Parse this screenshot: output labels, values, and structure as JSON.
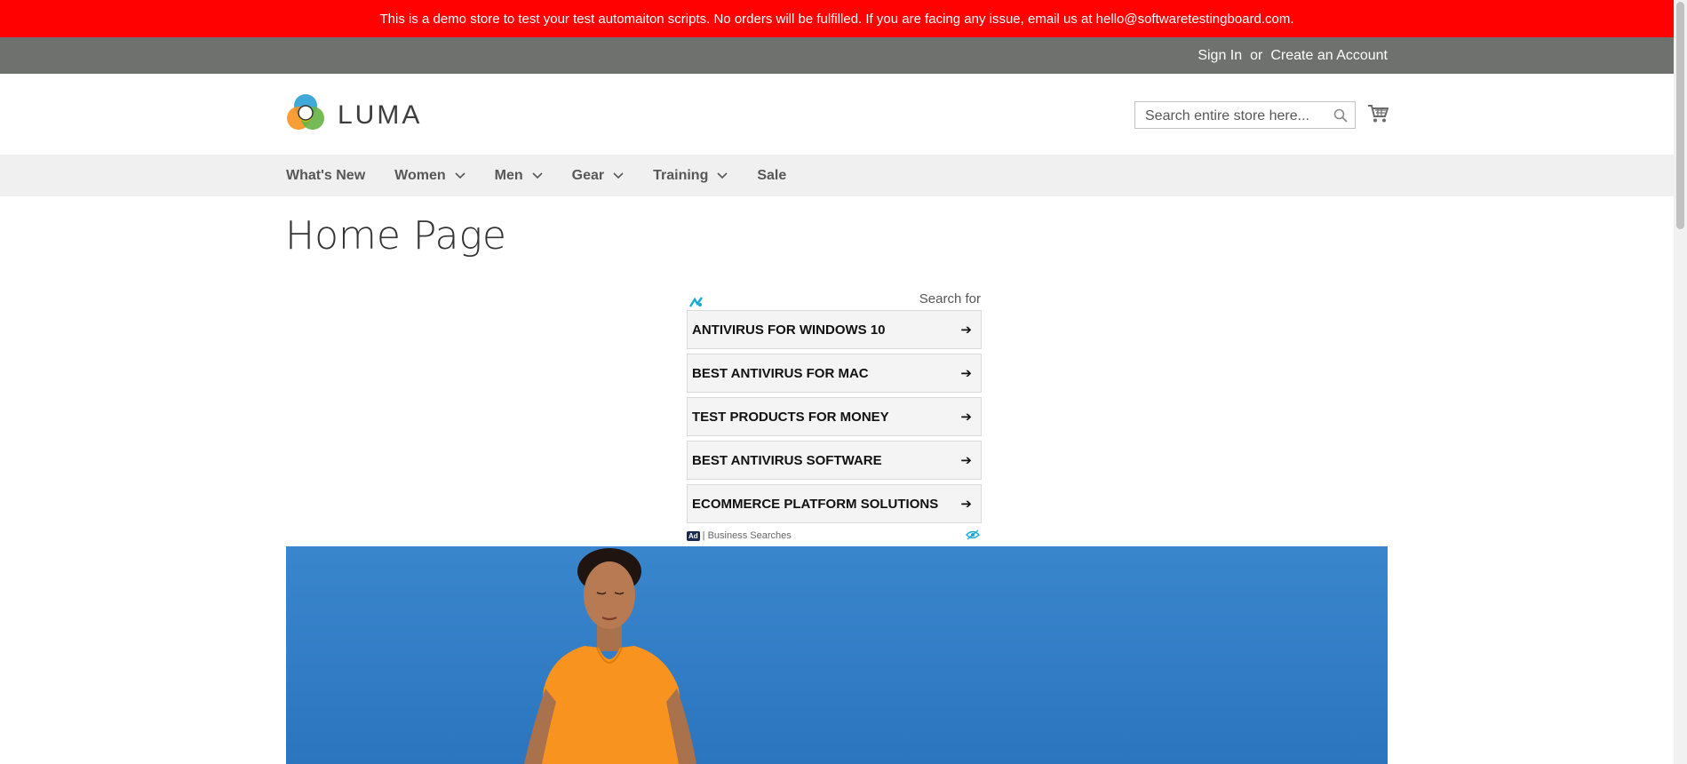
{
  "demo_notice": "This is a demo store to test your test automaiton scripts. No orders will be fulfilled. If you are facing any issue, email us at hello@softwaretestingboard.com.",
  "header_links": {
    "sign_in": "Sign In",
    "or": "or",
    "create_account": "Create an Account"
  },
  "logo": {
    "text": "LUMA",
    "icon": "luma-logo-icon"
  },
  "search": {
    "placeholder": "Search entire store here...",
    "icon": "search-icon"
  },
  "cart": {
    "icon": "cart-icon"
  },
  "nav": {
    "items": [
      {
        "label": "What's New",
        "has_dropdown": false
      },
      {
        "label": "Women",
        "has_dropdown": true
      },
      {
        "label": "Men",
        "has_dropdown": true
      },
      {
        "label": "Gear",
        "has_dropdown": true
      },
      {
        "label": "Training",
        "has_dropdown": true
      },
      {
        "label": "Sale",
        "has_dropdown": false
      }
    ]
  },
  "page_title": "Home Page",
  "ad": {
    "search_for": "Search for",
    "items": [
      "ANTIVIRUS FOR WINDOWS 10",
      "BEST ANTIVIRUS FOR MAC",
      "TEST PRODUCTS FOR MONEY",
      "BEST ANTIVIRUS SOFTWARE",
      "ECOMMERCE PLATFORM SOLUTIONS"
    ],
    "arrow": "➔",
    "badge": "Ad",
    "footer": "| Business Searches"
  },
  "colors": {
    "demo_bar": "#ff0101",
    "top_links_bar": "#6e716e",
    "nav_bar": "#f0f0f0",
    "hero_sky": "#2f7bc4",
    "shirt": "#f7931e"
  }
}
